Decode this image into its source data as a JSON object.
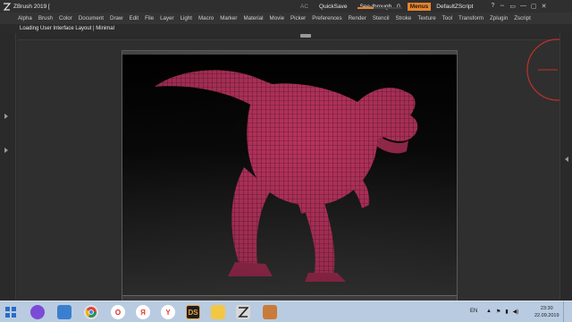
{
  "titlebar": {
    "app_title": "ZBrush 2019 [",
    "ac_label": "AC",
    "quicksave_label": "QuickSave",
    "seethrough_label": "See-through",
    "seethrough_value": "0",
    "menus_label": "Menus",
    "script_name": "DefaultZScript",
    "window_icons": [
      "?",
      "⇔",
      "▭",
      "—",
      "▢",
      "✕"
    ]
  },
  "menubar": {
    "items": [
      "Alpha",
      "Brush",
      "Color",
      "Document",
      "Draw",
      "Edit",
      "File",
      "Layer",
      "Light",
      "Macro",
      "Marker",
      "Material",
      "Movie",
      "Picker",
      "Preferences",
      "Render",
      "Stencil",
      "Stroke",
      "Texture",
      "Tool",
      "Transform",
      "Zplugin",
      "Zscript"
    ]
  },
  "status": {
    "text": "Loading User Interface Layout | Minimal"
  },
  "taskbar": {
    "lang": "EN",
    "tray": [
      "▲",
      "⚑",
      "▮",
      "◀)"
    ],
    "time": "23:30",
    "date": "22.09.2019",
    "colors": {
      "bar": "#b9cbe0",
      "accent": "#e8842a"
    }
  }
}
